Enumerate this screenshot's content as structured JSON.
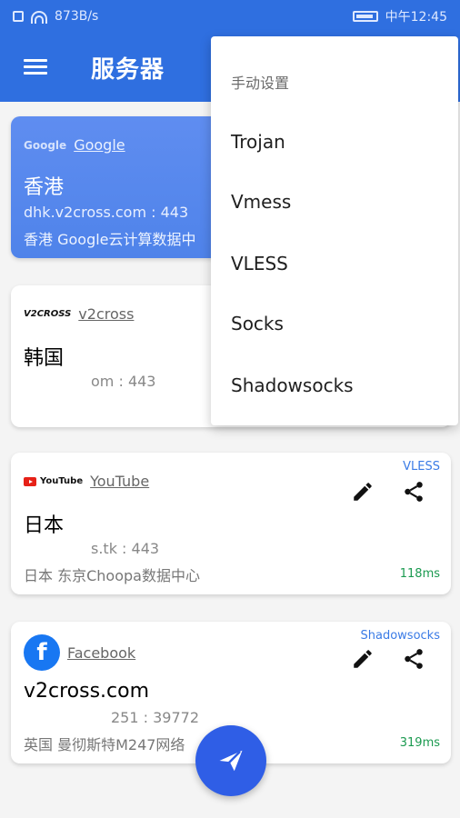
{
  "status_bar": {
    "speed": "873B/s",
    "time": "中午12:45"
  },
  "app_bar": {
    "title": "服务器"
  },
  "menu": {
    "header": "手动设置",
    "items": [
      "Trojan",
      "Vmess",
      "VLESS",
      "Socks",
      "Shadowsocks"
    ]
  },
  "cards": [
    {
      "brand_mark": "Google",
      "brand_name": "Google",
      "title": "香港",
      "host": "dhk.v2cross.com : 443",
      "location": "香港  Google云计算数据中"
    },
    {
      "brand_mark": "V2CROSS",
      "brand_name": "v2cross",
      "title": "韩国",
      "host": "om : 443"
    },
    {
      "protocol": "VLESS",
      "brand_mark": "YouTube",
      "brand_name": "YouTube",
      "title": "日本",
      "host": "s.tk : 443",
      "location": "日本  东京Choopa数据中心",
      "latency": "118ms"
    },
    {
      "protocol": "Shadowsocks",
      "brand_mark": "f",
      "brand_name": "Facebook",
      "title": "v2cross.com",
      "host": "251 : 39772",
      "location": "英国  曼彻斯特M247网络",
      "latency": "319ms"
    }
  ],
  "icons": {
    "menu": "hamburger-icon",
    "edit": "pencil-icon",
    "share": "share-icon",
    "fab": "paper-plane-icon"
  },
  "colors": {
    "primary": "#2f6fe0",
    "fab": "#2f5ee6",
    "latency": "#1b9a50",
    "protocol": "#3a7be6"
  }
}
